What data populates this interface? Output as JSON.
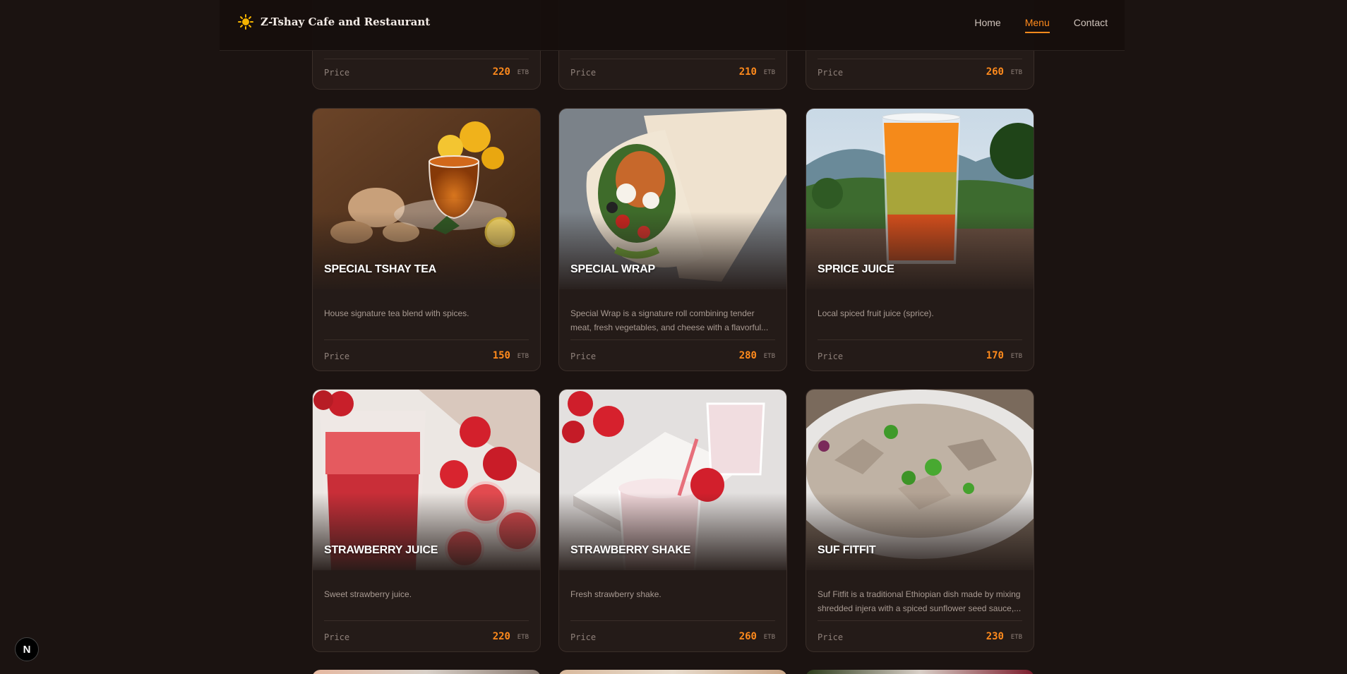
{
  "header": {
    "brand": "Z-Tshay Cafe and Restaurant",
    "nav": [
      {
        "label": "Home"
      },
      {
        "label": "Menu",
        "active": true
      },
      {
        "label": "Contact"
      }
    ]
  },
  "price_label": "Price",
  "currency": "ETB",
  "top_row": [
    {
      "price": "220"
    },
    {
      "price": "210"
    },
    {
      "price": "260"
    }
  ],
  "items": [
    {
      "title": "SPECIAL TSHAY TEA",
      "description": "House signature tea blend with spices.",
      "price": "150"
    },
    {
      "title": "SPECIAL WRAP",
      "description": "Special Wrap is a signature roll combining tender meat, fresh vegetables, and cheese with a flavorful...",
      "price": "280"
    },
    {
      "title": "SPRICE JUICE",
      "description": "Local spiced fruit juice (sprice).",
      "price": "170"
    },
    {
      "title": "STRAWBERRY JUICE",
      "description": "Sweet strawberry juice.",
      "price": "220"
    },
    {
      "title": "STRAWBERRY SHAKE",
      "description": "Fresh strawberry shake.",
      "price": "260"
    },
    {
      "title": "SUF FITFIT",
      "description": "Suf Fitfit is a traditional Ethiopian dish made by mixing shredded injera with a spiced sunflower seed sauce,...",
      "price": "230"
    }
  ],
  "dev_badge": "N",
  "colors": {
    "accent": "#ff8a1c",
    "background": "#1b1311",
    "card": "#241b18"
  }
}
